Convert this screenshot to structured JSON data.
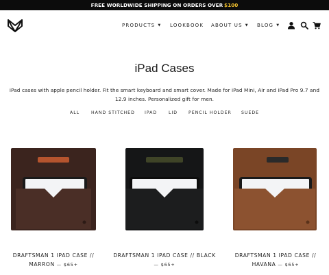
{
  "promo": {
    "text": "FREE WORLDWIDE SHIPPING ON ORDERS OVER",
    "amount": "$100"
  },
  "brand": {
    "logo_icon": "fox-logo-icon"
  },
  "nav": {
    "products": "PRODUCTS",
    "lookbook": "LOOKBOOK",
    "about": "ABOUT US",
    "blog": "BLOG",
    "caret": "▼",
    "icons": [
      "user-icon",
      "search-icon",
      "cart-icon"
    ]
  },
  "page": {
    "title": "iPad Cases",
    "description": "iPad cases with apple pencil holder. Fit the smart keyboard and smart cover. Made for iPad Mini, Air and iPad Pro 9.7 and 12.9 inches. Personalized gift for men."
  },
  "filters": [
    "ALL",
    "HAND STITCHED",
    "IPAD",
    "LID",
    "PENCIL HOLDER",
    "SUEDE"
  ],
  "products": [
    {
      "title_line1": "DRAFTSMAN 1 IPAD CASE //",
      "title_line2": "MARRON",
      "separator": "—",
      "price": "$65+",
      "leather_color": "#4a2e26",
      "strap_color": "#b5542e"
    },
    {
      "title_line1": "DRAFTSMAN 1 IPAD CASE // BLACK",
      "title_line2": "",
      "separator": "—",
      "price": "$65+",
      "leather_color": "#1c1d1e",
      "strap_color": "#4a4f2c"
    },
    {
      "title_line1": "DRAFTSMAN 1 IPAD CASE //",
      "title_line2": "HAVANA",
      "separator": "—",
      "price": "$65+",
      "leather_color": "#8c5230",
      "strap_color": "#2a2a2a"
    }
  ]
}
